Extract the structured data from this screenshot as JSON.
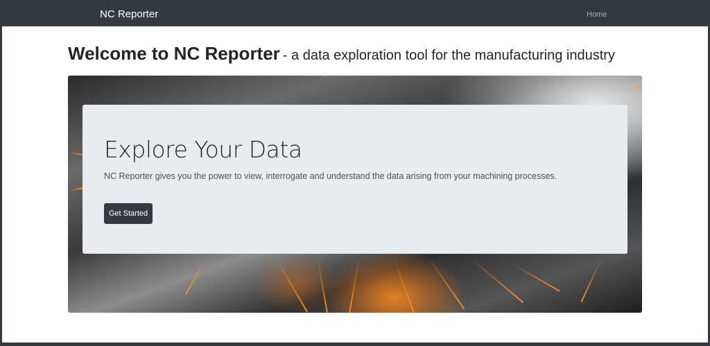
{
  "navbar": {
    "brand": "NC Reporter",
    "home_link": "Home"
  },
  "page": {
    "title_main": "Welcome to NC Reporter",
    "title_sub": "- a data exploration tool for the manufacturing industry"
  },
  "hero": {
    "heading": "Explore Your Data",
    "lead": "NC Reporter gives you the power to view, interrogate and understand the data arising from your machining processes.",
    "button_label": "Get Started"
  },
  "colors": {
    "navbar_bg": "#343a40",
    "jumbotron_bg": "#e9ecef",
    "button_bg": "#343a40",
    "page_bg": "#ffffff"
  }
}
